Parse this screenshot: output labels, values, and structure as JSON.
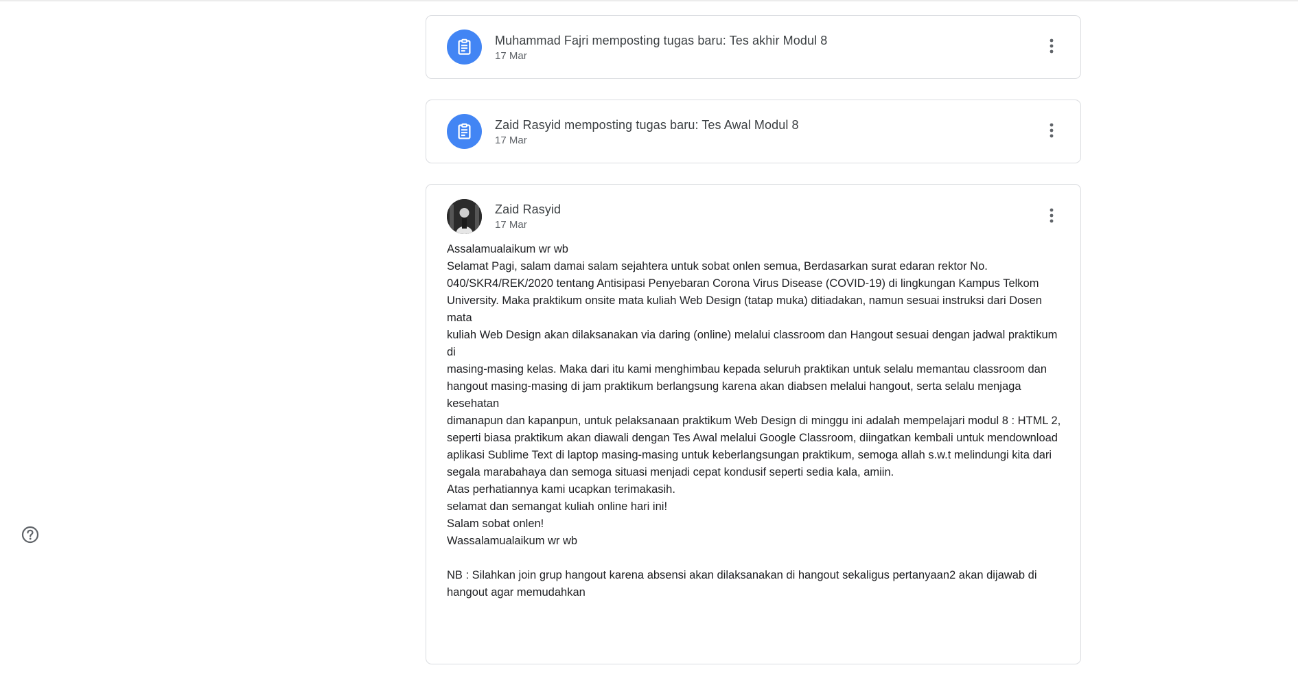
{
  "colors": {
    "accent": "#4285f4",
    "border": "#dadce0",
    "text_primary": "#3c4043",
    "text_secondary": "#5f6368"
  },
  "stream": {
    "items": [
      {
        "type": "assignment",
        "icon": "assignment-icon",
        "title": "Muhammad Fajri memposting tugas baru: Tes akhir Modul 8",
        "date": "17 Mar",
        "menu_icon": "more-vert-icon"
      },
      {
        "type": "assignment",
        "icon": "assignment-icon",
        "title": "Zaid Rasyid memposting tugas baru: Tes Awal Modul 8",
        "date": "17 Mar",
        "menu_icon": "more-vert-icon"
      },
      {
        "type": "announcement",
        "author": "Zaid Rasyid",
        "date": "17 Mar",
        "menu_icon": "more-vert-icon",
        "body": "Assalamualaikum wr wb\nSelamat Pagi, salam damai salam sejahtera untuk sobat onlen semua, Berdasarkan surat edaran rektor No.\n040/SKR4/REK/2020 tentang Antisipasi Penyebaran Corona Virus Disease (COVID-19) di lingkungan Kampus Telkom\nUniversity. Maka praktikum onsite mata kuliah Web Design (tatap muka) ditiadakan, namun sesuai instruksi dari Dosen mata\nkuliah Web Design akan dilaksanakan via daring (online) melalui classroom dan Hangout sesuai dengan jadwal praktikum di\nmasing-masing kelas. Maka dari itu kami menghimbau kepada seluruh praktikan untuk selalu memantau classroom dan\nhangout masing-masing di jam praktikum berlangsung karena akan diabsen melalui hangout, serta selalu menjaga kesehatan\ndimanapun dan kapanpun, untuk pelaksanaan praktikum Web Design di minggu ini adalah mempelajari modul 8 : HTML 2,\nseperti biasa praktikum akan diawali dengan Tes Awal melalui Google Classroom, diingatkan kembali untuk mendownload\naplikasi Sublime Text di laptop masing-masing untuk keberlangsungan praktikum, semoga allah s.w.t melindungi kita dari\nsegala marabahaya dan semoga situasi menjadi cepat kondusif seperti sedia kala, amiin.\nAtas perhatiannya kami ucapkan terimakasih.\nselamat dan semangat kuliah online hari ini!\nSalam sobat onlen!\nWassalamualaikum wr wb\n\nNB : Silahkan join grup hangout karena absensi akan dilaksanakan di hangout sekaligus pertanyaan2 akan dijawab di\nhangout agar memudahkan"
      }
    ]
  },
  "help": {
    "icon": "help-circle-icon"
  }
}
